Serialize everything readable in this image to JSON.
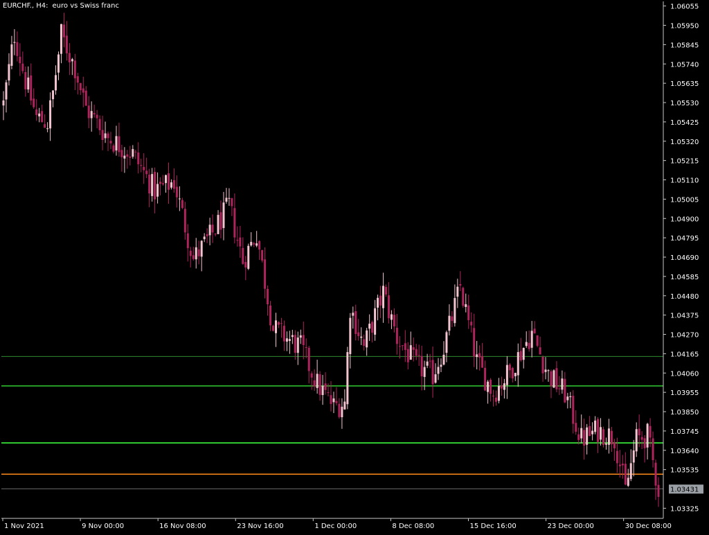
{
  "header": {
    "symbol": "EURCHF., H4:",
    "description": "euro vs Swiss franc"
  },
  "colors": {
    "background": "#000000",
    "axis": "#c8c8c8",
    "text": "#ffffff",
    "candle_bull": "#f2c4cf",
    "candle_bear": "#b0245e",
    "level_thin_green": "#2e8b2e",
    "level_green": "#32cd32",
    "level_orange": "#ff8c1a",
    "bid_line": "#8c8c8c",
    "price_box_bg": "#9aa0a6",
    "price_box_text": "#000000"
  },
  "chart_data": {
    "type": "candlestick",
    "title": "",
    "ylim": [
      1.0327,
      1.0608
    ],
    "y_ticks": [
      "1.06055",
      "1.05950",
      "1.05845",
      "1.05740",
      "1.05635",
      "1.05530",
      "1.05425",
      "1.05320",
      "1.05215",
      "1.05110",
      "1.05005",
      "1.04900",
      "1.04795",
      "1.04690",
      "1.04585",
      "1.04480",
      "1.04375",
      "1.04270",
      "1.04165",
      "1.04060",
      "1.03955",
      "1.03850",
      "1.03745",
      "1.03640",
      "1.03535",
      "1.03431",
      "1.03325"
    ],
    "x_ticks": [
      "1 Nov 2021",
      "9 Nov 00:00",
      "16 Nov 08:00",
      "23 Nov 16:00",
      "1 Dec 00:00",
      "8 Dec 08:00",
      "15 Dec 16:00",
      "23 Dec 00:00",
      "30 Dec 08:00"
    ],
    "current_price": "1.03431",
    "horizontal_levels": [
      {
        "value": 1.0415,
        "style": "thin_green"
      },
      {
        "value": 1.0399,
        "style": "green"
      },
      {
        "value": 1.0368,
        "style": "green_thick"
      },
      {
        "value": 1.0351,
        "style": "orange"
      }
    ],
    "anchors": [
      [
        0,
        1.0552
      ],
      [
        4,
        1.059
      ],
      [
        8,
        1.0565
      ],
      [
        12,
        1.0545
      ],
      [
        16,
        1.0542
      ],
      [
        18,
        1.0558
      ],
      [
        21,
        1.059
      ],
      [
        26,
        1.0572
      ],
      [
        30,
        1.055
      ],
      [
        38,
        1.0534
      ],
      [
        47,
        1.0525
      ],
      [
        55,
        1.0505
      ],
      [
        62,
        1.051
      ],
      [
        69,
        1.0468
      ],
      [
        76,
        1.0482
      ],
      [
        82,
        1.0497
      ],
      [
        87,
        1.0467
      ],
      [
        92,
        1.0482
      ],
      [
        98,
        1.043
      ],
      [
        108,
        1.042
      ],
      [
        114,
        1.04
      ],
      [
        120,
        1.0388
      ],
      [
        124,
        1.039
      ],
      [
        126,
        1.0442
      ],
      [
        131,
        1.042
      ],
      [
        138,
        1.045
      ],
      [
        143,
        1.0425
      ],
      [
        150,
        1.041
      ],
      [
        156,
        1.0405
      ],
      [
        160,
        1.042
      ],
      [
        166,
        1.0453
      ],
      [
        172,
        1.0412
      ],
      [
        178,
        1.0395
      ],
      [
        184,
        1.0407
      ],
      [
        192,
        1.0428
      ],
      [
        198,
        1.0405
      ],
      [
        204,
        1.0395
      ],
      [
        210,
        1.037
      ],
      [
        216,
        1.0375
      ],
      [
        222,
        1.0371
      ],
      [
        226,
        1.0342
      ],
      [
        230,
        1.037
      ],
      [
        234,
        1.0372
      ],
      [
        238,
        1.0343
      ]
    ],
    "bar_count": 239
  }
}
